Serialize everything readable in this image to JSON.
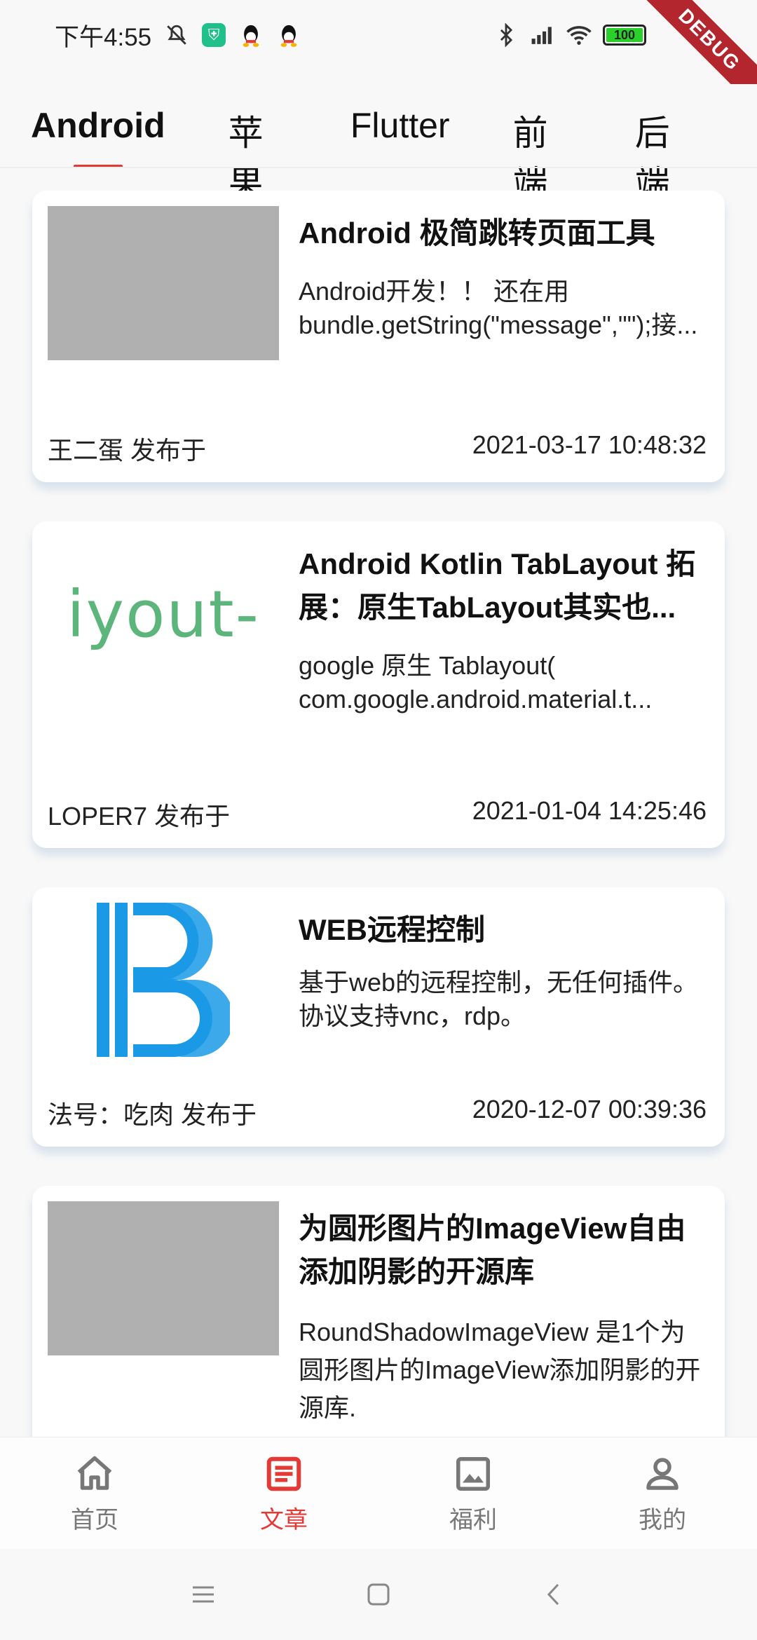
{
  "status": {
    "time": "下午4:55",
    "battery": "100",
    "debug": "DEBUG"
  },
  "tabs": [
    "Android",
    "苹果",
    "Flutter",
    "前端",
    "后端"
  ],
  "articles": [
    {
      "title": "Android 极简跳转页面工具",
      "desc": "Android开发！！ 还在用bundle.getString(\"message\",\"\");接...",
      "author": "王二蛋 发布于",
      "date": "2021-03-17 10:48:32",
      "thumb": "placeholder"
    },
    {
      "title": "Android Kotlin TabLayout 拓展：原生TabLayout其实也...",
      "desc": "google 原生 Tablayout( com.google.android.material.t...",
      "author": "LOPER7 发布于",
      "date": "2021-01-04 14:25:46",
      "thumb": "iyout-"
    },
    {
      "title": "WEB远程控制",
      "desc": "基于web的远程控制，无任何插件。协议支持vnc，rdp。",
      "author": "法号：吃肉 发布于",
      "date": "2020-12-07 00:39:36",
      "thumb": "logo"
    },
    {
      "title": "为圆形图片的ImageView自由添加阴影的开源库",
      "desc": "RoundShadowImageView 是1个为圆形图片的ImageView添加阴影的开源库.",
      "thumb": "placeholder"
    }
  ],
  "bottom_nav": [
    {
      "label": "首页",
      "icon": "home-icon"
    },
    {
      "label": "文章",
      "icon": "article-icon"
    },
    {
      "label": "福利",
      "icon": "image-icon"
    },
    {
      "label": "我的",
      "icon": "person-icon"
    }
  ],
  "colors": {
    "accent": "#e53935",
    "thumb_placeholder": "#b0b0b0",
    "logo_blue": "#1a9ae6",
    "layout_green": "#5cb57a"
  }
}
